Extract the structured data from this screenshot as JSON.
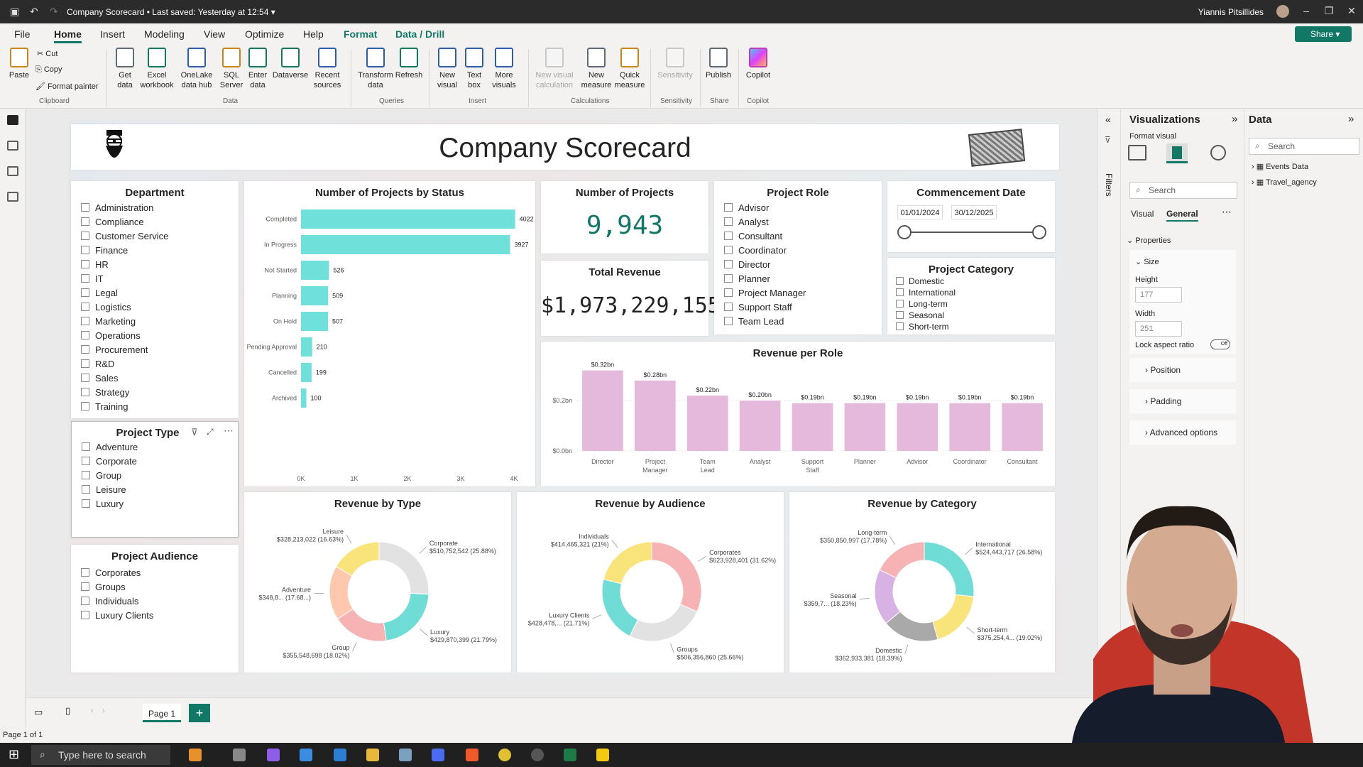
{
  "window": {
    "title": "Company Scorecard",
    "saved": "• Last saved: Yesterday at 12:54",
    "user": "Yiannis Pitsillides",
    "share": "Share"
  },
  "menu": [
    "File",
    "Home",
    "Insert",
    "Modeling",
    "View",
    "Optimize",
    "Help",
    "Format",
    "Data / Drill"
  ],
  "ribbon": {
    "clipboard": {
      "paste": "Paste",
      "cut": "Cut",
      "copy": "Copy",
      "format_painter": "Format painter",
      "group": "Clipboard"
    },
    "data": {
      "get_data": "Get data",
      "excel": "Excel workbook",
      "onelake": "OneLake data hub",
      "sql": "SQL Server",
      "enter": "Enter data",
      "dataverse": "Dataverse",
      "recent": "Recent sources",
      "group": "Data"
    },
    "queries": {
      "transform": "Transform data",
      "refresh": "Refresh",
      "group": "Queries"
    },
    "insert": {
      "new_visual": "New visual",
      "text_box": "Text box",
      "more_visuals": "More visuals",
      "group": "Insert"
    },
    "calculations": {
      "new_visual_calc": "New visual calculation",
      "new_measure": "New measure",
      "quick_measure": "Quick measure",
      "group": "Calculations"
    },
    "sensitivity": {
      "sensitivity": "Sensitivity",
      "group": "Sensitivity"
    },
    "share": {
      "publish": "Publish",
      "group": "Share"
    },
    "copilot": {
      "copilot": "Copilot",
      "group": "Copilot"
    }
  },
  "report": {
    "title": "Company Scorecard",
    "department": {
      "title": "Department",
      "items": [
        "Administration",
        "Compliance",
        "Customer Service",
        "Finance",
        "HR",
        "IT",
        "Legal",
        "Logistics",
        "Marketing",
        "Operations",
        "Procurement",
        "R&D",
        "Sales",
        "Strategy",
        "Training"
      ]
    },
    "project_type": {
      "title": "Project Type",
      "items": [
        "Adventure",
        "Corporate",
        "Group",
        "Leisure",
        "Luxury"
      ]
    },
    "project_audience": {
      "title": "Project Audience",
      "items": [
        "Corporates",
        "Groups",
        "Individuals",
        "Luxury Clients"
      ]
    },
    "kpi_projects": {
      "title": "Number of Projects",
      "value": "9,943"
    },
    "kpi_revenue": {
      "title": "Total Revenue",
      "value": "$1,973,229,155"
    },
    "project_role": {
      "title": "Project Role",
      "items": [
        "Advisor",
        "Analyst",
        "Consultant",
        "Coordinator",
        "Director",
        "Planner",
        "Project Manager",
        "Support Staff",
        "Team Lead"
      ]
    },
    "commencement": {
      "title": "Commencement Date",
      "start": "01/01/2024",
      "end": "30/12/2025"
    },
    "project_category": {
      "title": "Project Category",
      "items": [
        "Domestic",
        "International",
        "Long-term",
        "Seasonal",
        "Short-term"
      ]
    }
  },
  "chart_data": [
    {
      "id": "status",
      "type": "bar",
      "title": "Number of Projects by Status",
      "orientation": "horizontal",
      "categories": [
        "Completed",
        "In Progress",
        "Not Started",
        "Planning",
        "On Hold",
        "Pending Approval",
        "Cancelled",
        "Archived"
      ],
      "values": [
        4022,
        3927,
        526,
        509,
        507,
        210,
        199,
        100
      ],
      "labels": [
        "4022",
        "3927",
        "526",
        "509",
        "507",
        "210",
        "199",
        "100"
      ],
      "xticks": [
        "0K",
        "1K",
        "2K",
        "3K",
        "4K"
      ],
      "xlim": [
        0,
        4000
      ],
      "color": "#6fe0da"
    },
    {
      "id": "role",
      "type": "bar",
      "title": "Revenue per Role",
      "categories": [
        "Director",
        "Project Manager",
        "Team Lead",
        "Analyst",
        "Support Staff",
        "Planner",
        "Advisor",
        "Coordinator",
        "Consultant"
      ],
      "values": [
        0.32,
        0.28,
        0.22,
        0.2,
        0.19,
        0.19,
        0.19,
        0.19,
        0.19
      ],
      "labels": [
        "$0.32bn",
        "$0.28bn",
        "$0.22bn",
        "$0.20bn",
        "$0.19bn",
        "$0.19bn",
        "$0.19bn",
        "$0.19bn",
        "$0.19bn"
      ],
      "yticks": [
        "$0.0bn",
        "$0.2bn"
      ],
      "ylim": [
        0,
        0.35
      ],
      "color": "#e4b9dc"
    },
    {
      "id": "type",
      "type": "pie",
      "title": "Revenue by Type",
      "donut": true,
      "slices": [
        {
          "name": "Corporate",
          "value": 25.88,
          "label": "$510,752,542 (25.88%)",
          "color": "#e2e2e2"
        },
        {
          "name": "Luxury",
          "value": 21.79,
          "label": "$429,870,399 (21.79%)",
          "color": "#6fdcd6"
        },
        {
          "name": "Group",
          "value": 18.02,
          "label": "$355,548,698 (18.02%)",
          "color": "#f7b2b4"
        },
        {
          "name": "Adventure",
          "value": 17.68,
          "label": "$348,8... (17.68...)",
          "color": "#ffc8ae"
        },
        {
          "name": "Leisure",
          "value": 16.63,
          "label": "$328,213,022 (16.63%)",
          "color": "#f8e47a"
        }
      ]
    },
    {
      "id": "audience",
      "type": "pie",
      "title": "Revenue by Audience",
      "donut": true,
      "slices": [
        {
          "name": "Corporates",
          "value": 31.62,
          "label": "$623,928,401 (31.62%)",
          "color": "#f7b2b4"
        },
        {
          "name": "Groups",
          "value": 25.66,
          "label": "$506,356,860 (25.66%)",
          "color": "#e2e2e2"
        },
        {
          "name": "Luxury Clients",
          "value": 21.71,
          "label": "$428,478,... (21.71%)",
          "color": "#6fdcd6"
        },
        {
          "name": "Individuals",
          "value": 21,
          "label": "$414,465,321 (21%)",
          "color": "#f8e47a"
        }
      ]
    },
    {
      "id": "category",
      "type": "pie",
      "title": "Revenue by Category",
      "donut": true,
      "slices": [
        {
          "name": "International",
          "value": 26.58,
          "label": "$524,443,717 (26.58%)",
          "color": "#6fdcd6"
        },
        {
          "name": "Short-term",
          "value": 19.02,
          "label": "$375,254,4... (19.02%)",
          "color": "#f8e47a"
        },
        {
          "name": "Domestic",
          "value": 18.39,
          "label": "$362,933,381 (18.39%)",
          "color": "#a9a9a9"
        },
        {
          "name": "Seasonal",
          "value": 18.23,
          "label": "$359,7... (18.23%)",
          "color": "#d8b2e4"
        },
        {
          "name": "Long-term",
          "value": 17.78,
          "label": "$350,850,997 (17.78%)",
          "color": "#f7b2b4"
        }
      ]
    }
  ],
  "filters": {
    "label": "Filters"
  },
  "visualizations": {
    "title": "Visualizations",
    "subtitle": "Format visual",
    "search": "Search",
    "tab_visual": "Visual",
    "tab_general": "General",
    "properties": "Properties",
    "size": "Size",
    "height_label": "Height",
    "height_value": "177",
    "width_label": "Width",
    "width_value": "251",
    "lock_aspect": "Lock aspect ratio",
    "toggle": "Off",
    "position": "Position",
    "padding": "Padding",
    "advanced": "Advanced options"
  },
  "data_pane": {
    "title": "Data",
    "search": "Search",
    "tables": [
      "Events Data",
      "Travel_agency"
    ]
  },
  "pages": {
    "tab": "Page 1",
    "add": "+"
  },
  "status": "Page 1 of 1",
  "taskbar": {
    "search": "Type here to search"
  }
}
